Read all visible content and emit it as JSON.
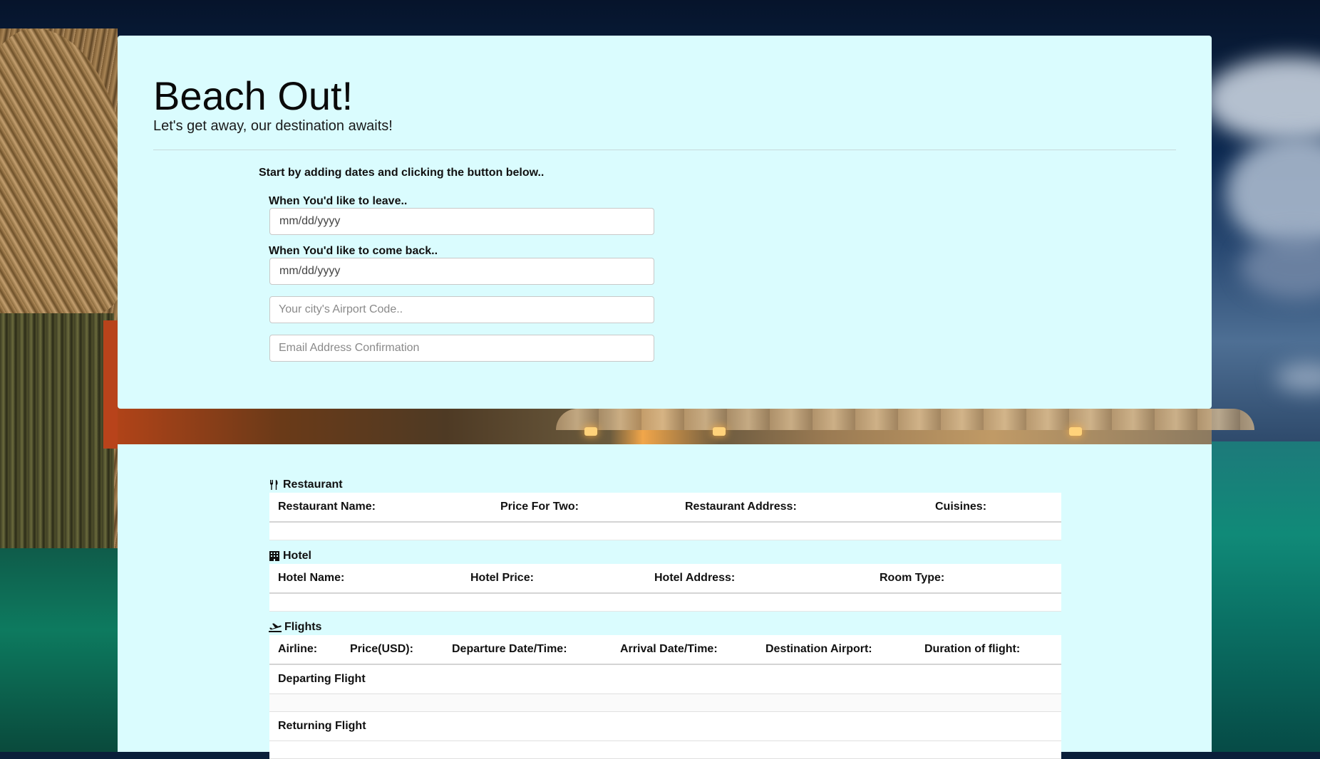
{
  "header": {
    "title": "Beach Out!",
    "subtitle": "Let's get away, our destination awaits!"
  },
  "form": {
    "instructions": "Start by adding dates and clicking the button below..",
    "leave_label": "When You'd like to leave..",
    "leave_value": "mm/dd/yyyy",
    "return_label": "When You'd like to come back..",
    "return_value": "mm/dd/yyyy",
    "airport_placeholder": "Your city's Airport Code..",
    "email_placeholder": "Email Address Confirmation"
  },
  "restaurant": {
    "title": "Restaurant",
    "icon": "fork-knife-icon",
    "columns": [
      "Restaurant Name:",
      "Price For Two:",
      "Restaurant Address:",
      "Cuisines:"
    ]
  },
  "hotel": {
    "title": "Hotel",
    "icon": "building-icon",
    "columns": [
      "Hotel Name:",
      "Hotel Price:",
      "Hotel Address:",
      "Room Type:"
    ]
  },
  "flights": {
    "title": "Flights",
    "icon": "plane-departure-icon",
    "columns": [
      "Airline:",
      "Price(USD):",
      "Departure Date/Time:",
      "Arrival Date/Time:",
      "Destination Airport:",
      "Duration of flight:"
    ],
    "rows": [
      "Departing Flight",
      "Returning Flight"
    ]
  },
  "colors": {
    "panel_bg": "#dafcfe",
    "text": "#111111"
  }
}
